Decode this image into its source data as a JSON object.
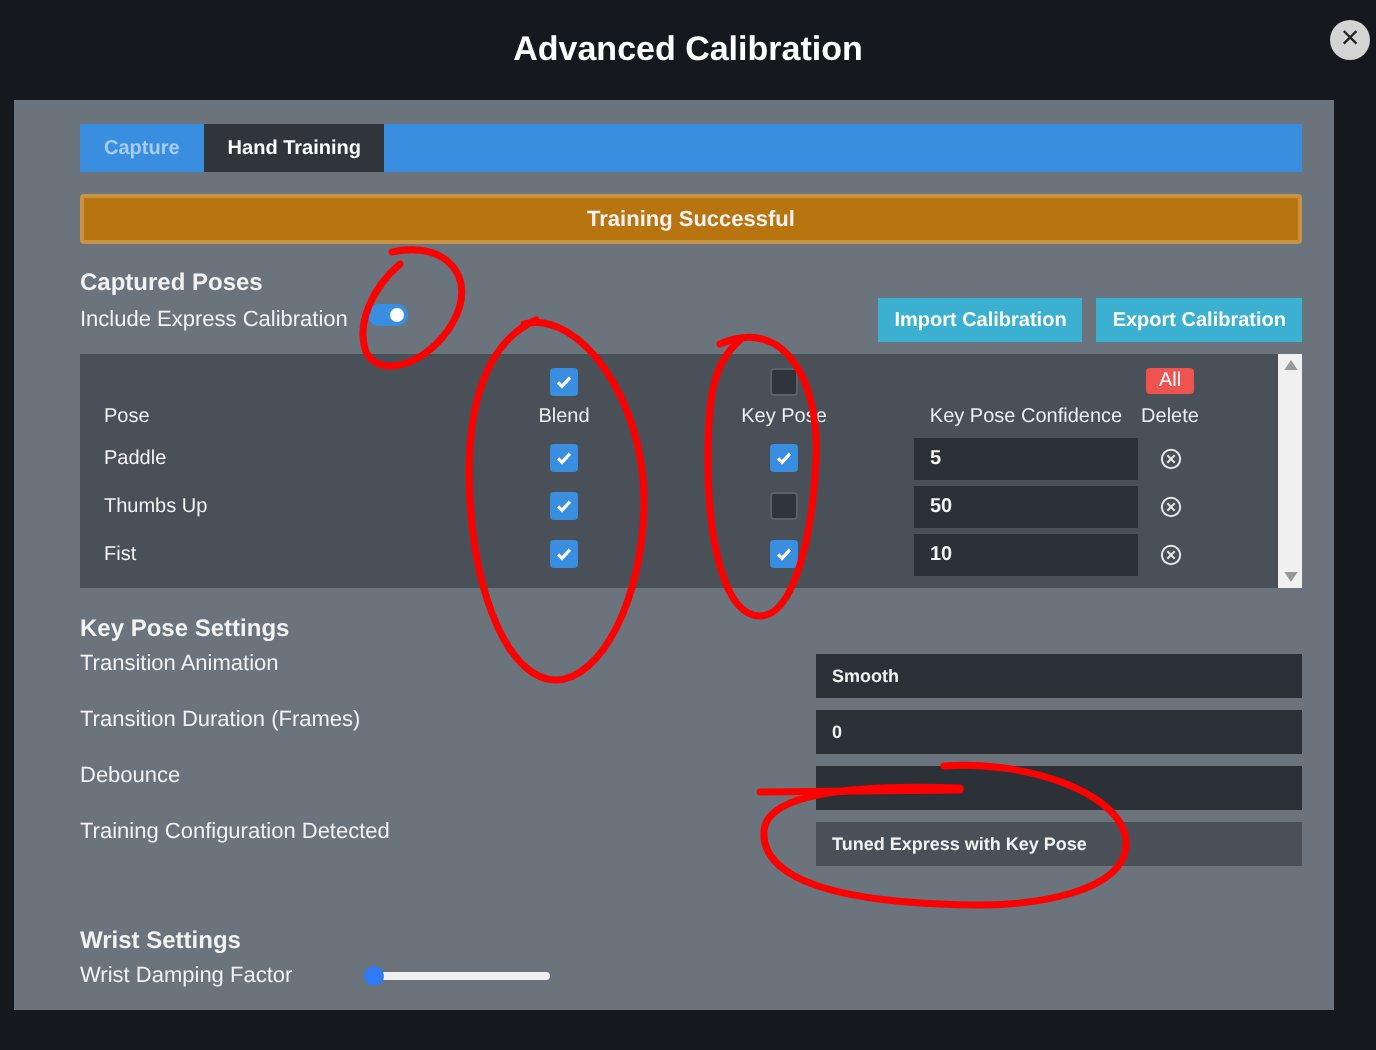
{
  "window": {
    "title": "Advanced Calibration",
    "close": "×"
  },
  "tabs": [
    {
      "label": "Capture",
      "selected": false
    },
    {
      "label": "Hand Training",
      "selected": true
    }
  ],
  "banner": "Training Successful",
  "captured_poses": {
    "title": "Captured Poses",
    "toggle_label": "Include Express Calibration",
    "toggle_on": true,
    "buttons": [
      "Import Calibration",
      "Export Calibration"
    ],
    "header_checks": {
      "blend": true,
      "key_pose": false
    },
    "delete_all": "All",
    "columns": [
      "Pose",
      "Blend",
      "Key Pose",
      "Key Pose Confidence",
      "Delete"
    ],
    "rows": [
      {
        "pose": "Paddle",
        "blend": true,
        "key_pose": true,
        "confidence": "5"
      },
      {
        "pose": "Thumbs Up",
        "blend": true,
        "key_pose": false,
        "confidence": "50"
      },
      {
        "pose": "Fist",
        "blend": true,
        "key_pose": true,
        "confidence": "10"
      }
    ]
  },
  "key_pose_settings": {
    "title": "Key Pose Settings",
    "rows": [
      {
        "label": "Transition Animation",
        "value": "Smooth",
        "disabled": false
      },
      {
        "label": "Transition Duration (Frames)",
        "value": "0",
        "disabled": false
      },
      {
        "label": "Debounce",
        "disabled": false
      },
      {
        "label": "Training Configuration Detected",
        "value": "Tuned Express with Key Pose",
        "disabled": true
      }
    ]
  },
  "wrist_settings": {
    "title": "Wrist Settings",
    "label": "Wrist Damping Factor",
    "level": 0
  }
}
